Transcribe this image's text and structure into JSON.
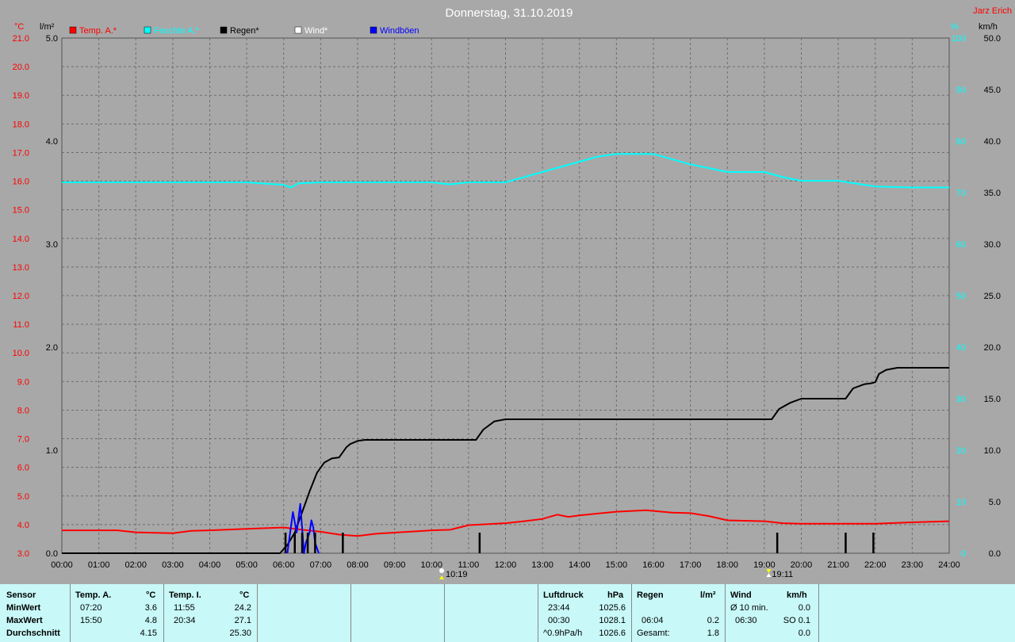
{
  "header": {
    "title": "Donnerstag, 31.10.2019",
    "station": "Jarz Erich"
  },
  "axes": {
    "left1_unit": "°C",
    "left2_unit": "l/m²",
    "right1_unit": "%",
    "right2_unit": "km/h"
  },
  "legend": [
    {
      "label": "Temp. A.*",
      "color": "#ff0000"
    },
    {
      "label": "Feuchte A.*",
      "color": "#00ffff"
    },
    {
      "label": "Regen*",
      "color": "#000000"
    },
    {
      "label": "Wind*",
      "color": "#ffffff"
    },
    {
      "label": "Windböen",
      "color": "#0000ff"
    }
  ],
  "markers": {
    "sunrise": "10:19",
    "sunset": "19:11"
  },
  "chart_data": {
    "type": "line",
    "x_ticks": [
      "00:00",
      "01:00",
      "02:00",
      "03:00",
      "04:00",
      "05:00",
      "06:00",
      "07:00",
      "08:00",
      "09:00",
      "10:00",
      "11:00",
      "12:00",
      "13:00",
      "14:00",
      "15:00",
      "16:00",
      "17:00",
      "18:00",
      "19:00",
      "20:00",
      "21:00",
      "22:00",
      "23:00",
      "24:00"
    ],
    "temp_ticks": [
      "21.0",
      "20.0",
      "19.0",
      "18.0",
      "17.0",
      "16.0",
      "15.0",
      "14.0",
      "13.0",
      "12.0",
      "11.0",
      "10.0",
      "9.0",
      "8.0",
      "7.0",
      "6.0",
      "5.0",
      "4.0",
      "3.0"
    ],
    "rain_ticks": [
      "5.0",
      "4.0",
      "3.0",
      "2.0",
      "1.0",
      "0.0"
    ],
    "humidity_ticks": [
      "100",
      "90",
      "80",
      "70",
      "60",
      "50",
      "40",
      "30",
      "20",
      "10",
      "0"
    ],
    "wind_ticks": [
      "50.0",
      "45.0",
      "40.0",
      "35.0",
      "30.0",
      "25.0",
      "20.0",
      "15.0",
      "10.0",
      "5.0",
      "0.0"
    ],
    "ylim_temp": [
      3,
      21
    ],
    "ylim_rain": [
      0,
      5
    ],
    "ylim_humidity": [
      0,
      100
    ],
    "ylim_wind": [
      0,
      50
    ],
    "xlim_hours": [
      0,
      24
    ],
    "series": [
      {
        "name": "Temp. A.*",
        "axis": "temp",
        "color": "#ff0000",
        "x": [
          0,
          1.5,
          2,
          3,
          3.5,
          4,
          5,
          6,
          6.5,
          7,
          7.5,
          8,
          8.5,
          9,
          10,
          10.5,
          11,
          12,
          12.5,
          13,
          13.4,
          13.7,
          14,
          15,
          15.8,
          16,
          16.5,
          17,
          17.5,
          18,
          19,
          19.5,
          20,
          21,
          22,
          23,
          24
        ],
        "y": [
          3.8,
          3.8,
          3.73,
          3.7,
          3.78,
          3.8,
          3.85,
          3.9,
          3.82,
          3.75,
          3.65,
          3.6,
          3.68,
          3.72,
          3.8,
          3.82,
          3.98,
          4.05,
          4.12,
          4.2,
          4.35,
          4.27,
          4.32,
          4.45,
          4.5,
          4.48,
          4.42,
          4.4,
          4.3,
          4.15,
          4.12,
          4.05,
          4.03,
          4.03,
          4.03,
          4.08,
          4.12
        ]
      },
      {
        "name": "Feuchte A.*",
        "axis": "humidity",
        "color": "#00ffff",
        "x": [
          0,
          5,
          6,
          6.2,
          6.4,
          7,
          8,
          10,
          10.5,
          11,
          12,
          12.5,
          13,
          13.5,
          14,
          14.5,
          15,
          15.5,
          16,
          17,
          18,
          19,
          19.5,
          20,
          21,
          22,
          23,
          24
        ],
        "y": [
          72,
          72,
          71.5,
          71,
          71.8,
          72,
          72,
          72,
          71.6,
          72,
          72,
          73,
          74,
          75,
          76,
          77,
          77.5,
          77.5,
          77.5,
          75.5,
          74,
          74,
          73,
          72.3,
          72.3,
          71.2,
          71,
          71
        ]
      },
      {
        "name": "Regen*",
        "axis": "rain",
        "color": "#000000",
        "x": [
          0,
          5.9,
          6.1,
          6.3,
          6.5,
          6.7,
          6.9,
          7.1,
          7.3,
          7.5,
          7.6,
          7.7,
          7.8,
          8,
          8.2,
          8.5,
          9,
          10,
          11.2,
          11.4,
          11.7,
          12,
          13,
          14,
          15,
          16,
          17,
          18,
          19.2,
          19.4,
          19.7,
          20,
          20.5,
          21.2,
          21.4,
          21.7,
          21.9,
          22,
          22.1,
          22.3,
          22.6,
          23,
          24
        ],
        "y": [
          0,
          0,
          0.08,
          0.2,
          0.4,
          0.6,
          0.78,
          0.88,
          0.92,
          0.93,
          0.98,
          1.03,
          1.06,
          1.09,
          1.1,
          1.1,
          1.1,
          1.1,
          1.1,
          1.2,
          1.28,
          1.3,
          1.3,
          1.3,
          1.3,
          1.3,
          1.3,
          1.3,
          1.3,
          1.4,
          1.46,
          1.5,
          1.5,
          1.5,
          1.6,
          1.64,
          1.65,
          1.66,
          1.74,
          1.78,
          1.8,
          1.8,
          1.8
        ]
      },
      {
        "name": "Windböen",
        "axis": "wind",
        "color": "#0000ff",
        "x": [
          6.1,
          6.25,
          6.35,
          6.45,
          6.55,
          6.6,
          6.7,
          6.75,
          6.8,
          6.85,
          6.95
        ],
        "y": [
          0,
          4,
          2,
          4.8,
          0,
          1,
          2,
          3.2,
          2.5,
          1,
          0
        ]
      },
      {
        "name": "rain_events",
        "axis": "rain",
        "color": "#000000",
        "x": [
          6.05,
          6.3,
          6.5,
          6.65,
          6.85,
          7.6,
          11.3,
          19.35,
          21.2,
          21.95
        ],
        "y": [
          0.2,
          0.2,
          0.2,
          0.2,
          0.2,
          0.2,
          0.2,
          0.2,
          0.2,
          0.2
        ]
      }
    ]
  },
  "summary": {
    "sensor": {
      "header": "Sensor",
      "rows": [
        "MinWert",
        "MaxWert",
        "Durchschnitt"
      ]
    },
    "temp_a": {
      "header": "Temp. A.",
      "unit": "°C",
      "min_time": "07:20",
      "min_val": "3.6",
      "max_time": "15:50",
      "max_val": "4.8",
      "avg": "4.15"
    },
    "temp_i": {
      "header": "Temp. I.",
      "unit": "°C",
      "min_time": "11:55",
      "min_val": "24.2",
      "max_time": "20:34",
      "max_val": "27.1",
      "avg": "25.30"
    },
    "pressure": {
      "header": "Luftdruck",
      "unit": "hPa",
      "min_time": "23:44",
      "min_val": "1025.6",
      "max_time": "00:30",
      "max_val": "1028.1",
      "trend_label": "^0.9hPa/h",
      "trend_val": "1026.6"
    },
    "rain": {
      "header": "Regen",
      "unit": "l/m²",
      "max_time": "06:04",
      "max_val": "0.2",
      "total_label": "Gesamt:",
      "total_val": "1.8"
    },
    "wind": {
      "header": "Wind",
      "unit": "km/h",
      "avg_label": "Ø 10 min.",
      "avg_val": "0.0",
      "gust_time": "06:30",
      "gust_val": "SO 0.1",
      "last_val": "0.0"
    }
  }
}
